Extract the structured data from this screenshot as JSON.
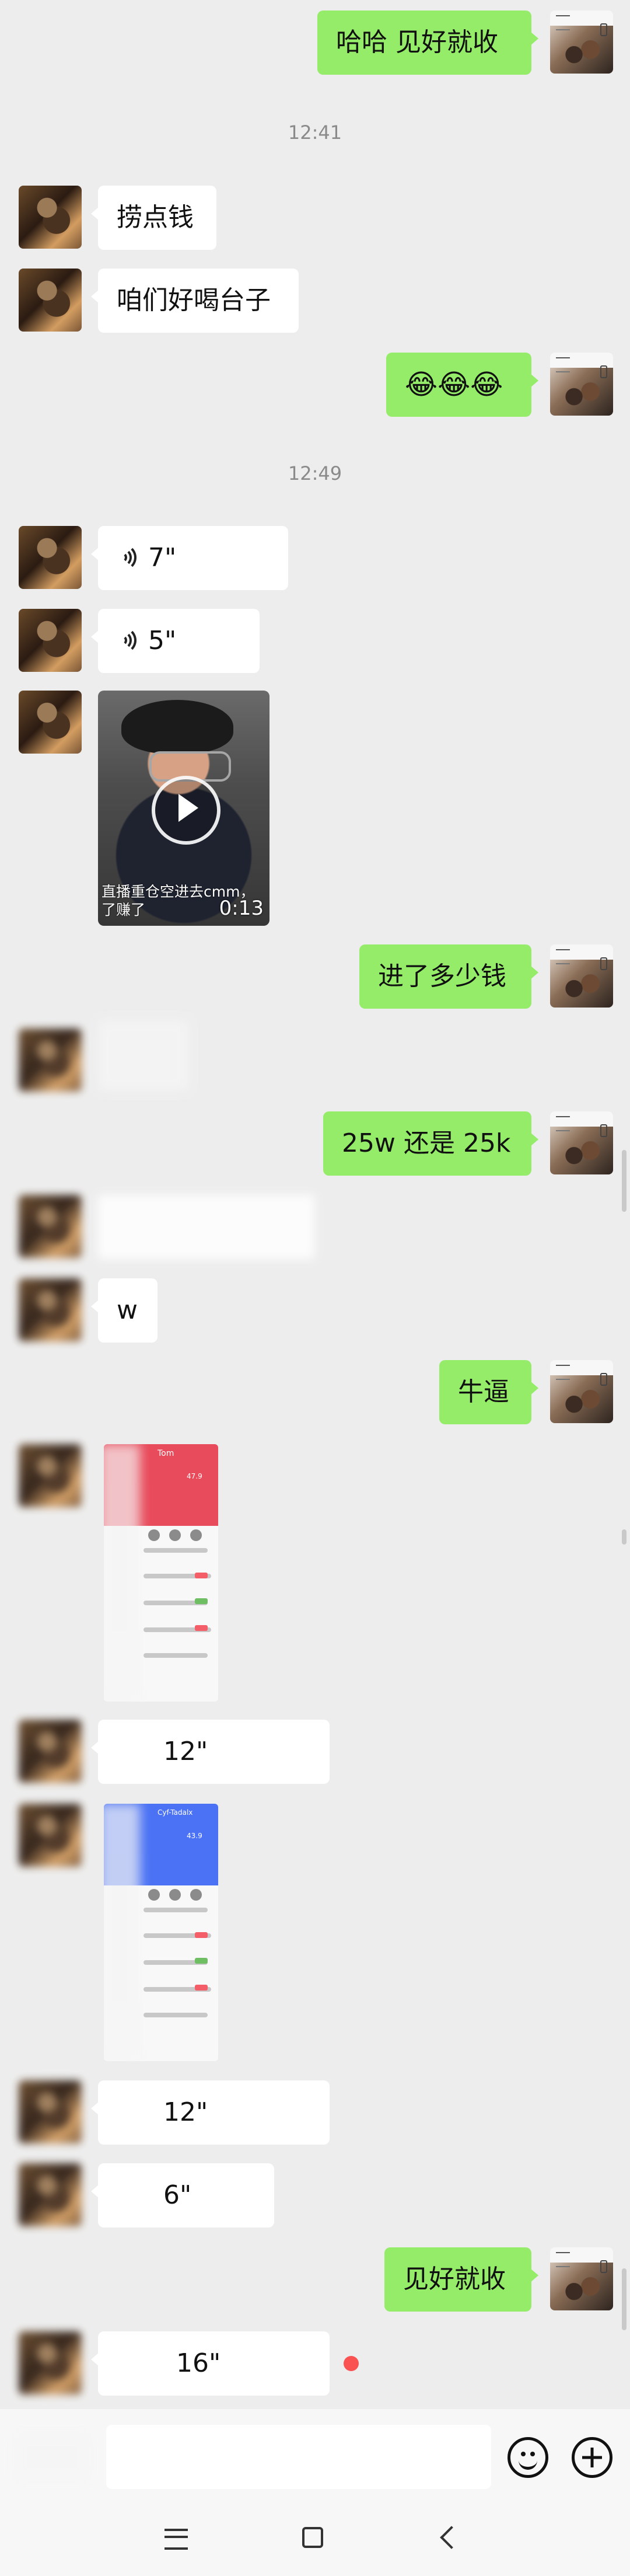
{
  "conversation": {
    "times": [
      "12:41",
      "12:49"
    ],
    "messages": [
      {
        "side": "out",
        "type": "text",
        "text": "哈哈  见好就收"
      },
      {
        "side": "in",
        "type": "text",
        "text": "捞点钱"
      },
      {
        "side": "in",
        "type": "text",
        "text": "咱们好喝台子"
      },
      {
        "side": "out",
        "type": "text",
        "text": "😂😂😂"
      },
      {
        "side": "in",
        "type": "voice",
        "duration": "7\""
      },
      {
        "side": "in",
        "type": "voice",
        "duration": "5\""
      },
      {
        "side": "in",
        "type": "video",
        "caption": "直播重仓空进去cmm，了赚了",
        "duration": "0:13"
      },
      {
        "side": "out",
        "type": "text",
        "text": "进了多少钱"
      },
      {
        "side": "out",
        "type": "text",
        "text": "25w  还是 25k"
      },
      {
        "side": "in",
        "type": "text",
        "text": "w"
      },
      {
        "side": "out",
        "type": "text",
        "text": "牛逼"
      },
      {
        "side": "in",
        "type": "voice",
        "duration": "12\""
      },
      {
        "side": "in",
        "type": "voice",
        "duration": "12\""
      },
      {
        "side": "in",
        "type": "voice",
        "duration": "6\""
      },
      {
        "side": "out",
        "type": "text",
        "text": "见好就收"
      },
      {
        "side": "in",
        "type": "voice",
        "duration": "16\""
      }
    ]
  },
  "screenshots": [
    {
      "title": "Tom",
      "brand_color": "#e84b5b",
      "value": "47.9"
    },
    {
      "title": "Cyf-Tadalx",
      "brand_color": "#4b72f4",
      "value": "43.9"
    }
  ],
  "colors": {
    "chat_background": "#ededed",
    "outgoing_bubble": "#95ec69",
    "incoming_bubble": "#ffffff",
    "unread_dot": "#fa5151"
  },
  "icons": {
    "voice": "voice-icon",
    "play": "play-icon",
    "emoji": "emoji-icon",
    "plus": "plus-icon",
    "menu": "menu-icon",
    "home": "home-icon",
    "back": "back-icon"
  }
}
